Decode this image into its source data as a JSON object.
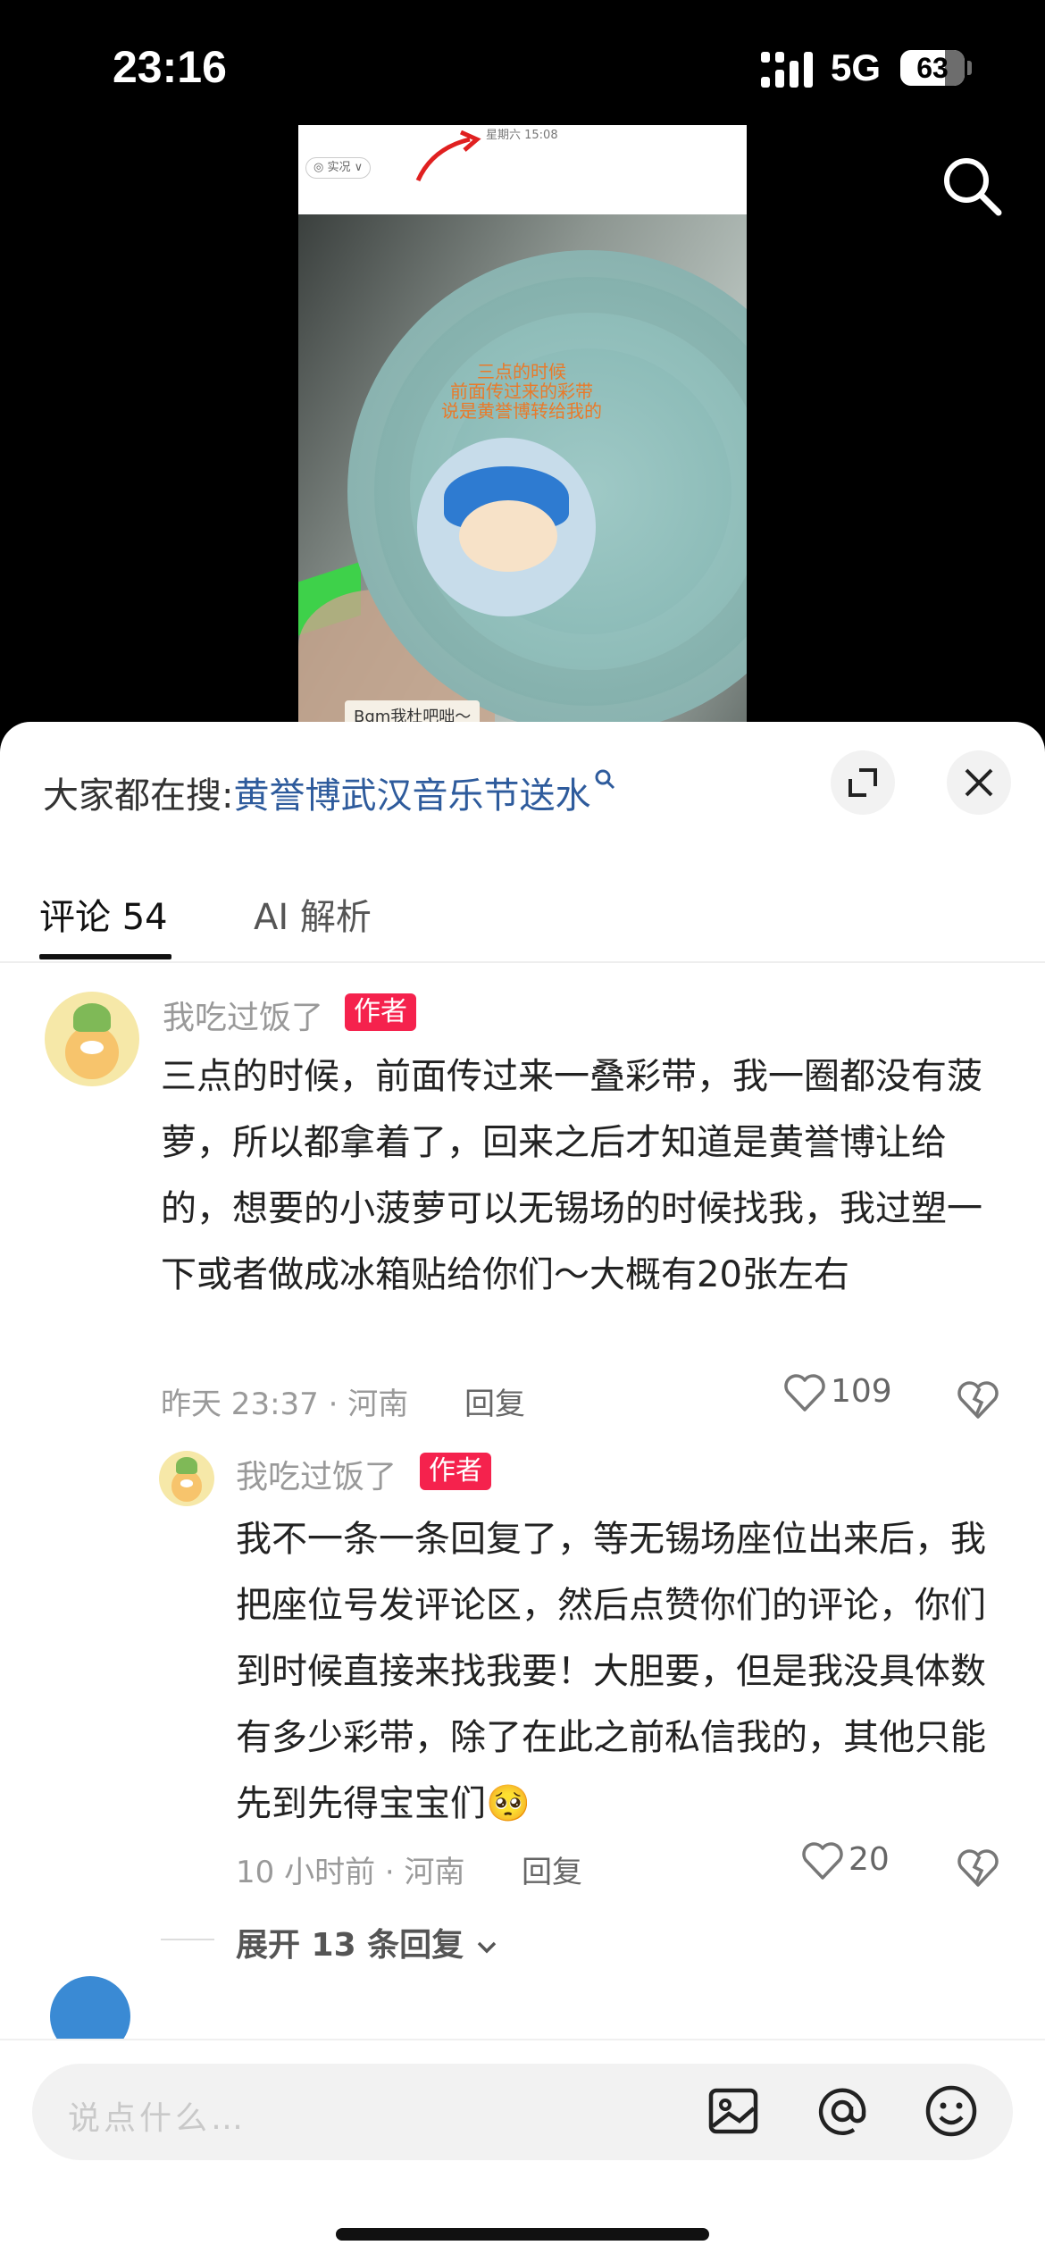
{
  "status_bar": {
    "time": "23:16",
    "network": "5G",
    "battery": "63",
    "battery_level_percent": 63
  },
  "video": {
    "phone_time": "星期六 15:08",
    "live_label": "◎ 实况 ∨",
    "overlay_text": "三点的时候\n前面传过来的彩带\n说是黄誉博转给我的",
    "bottom_text": "Bgm我杜吧咄～"
  },
  "trending": {
    "prefix": "大家都在搜:",
    "query": "黄誉博武汉音乐节送水"
  },
  "tabs": {
    "comments": "评论 54",
    "ai": "AI 解析"
  },
  "comments": [
    {
      "username": "我吃过饭了",
      "badge": "作者",
      "text": "三点的时候，前面传过来一叠彩带，我一圈都没有菠萝，所以都拿着了，回来之后才知道是黄誉博让给的，想要的小菠萝可以无锡场的时候找我，我过塑一下或者做成冰箱贴给你们～大概有20张左右",
      "meta": "昨天 23:37 · 河南",
      "reply": "回复",
      "likes": "109"
    }
  ],
  "reply": {
    "username": "我吃过饭了",
    "badge": "作者",
    "text": "我不一条一条回复了，等无锡场座位出来后，我把座位号发评论区，然后点赞你们的评论，你们到时候直接来找我要！大胆要，但是我没具体数有多少彩带，除了在此之前私信我的，其他只能先到先得宝宝们🥺",
    "meta": "10 小时前 · 河南",
    "reply": "回复",
    "likes": "20"
  },
  "expand_label": "展开 13 条回复",
  "composer": {
    "placeholder": "说点什么…",
    "icons": [
      "image-icon",
      "at-icon",
      "emoji-icon"
    ]
  },
  "colors": {
    "badge": "#f5224d",
    "link": "#2e5b9c"
  }
}
